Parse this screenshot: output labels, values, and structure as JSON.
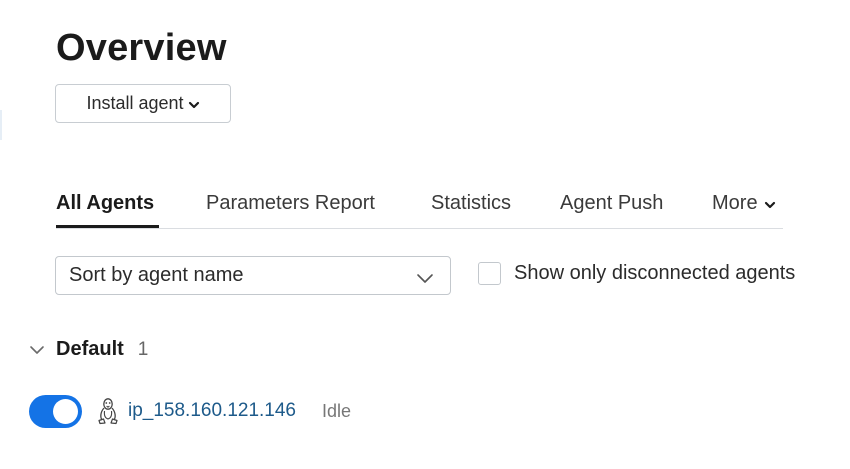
{
  "page": {
    "title": "Overview"
  },
  "toolbar": {
    "install_label": "Install agent"
  },
  "tabs": [
    {
      "label": "All Agents",
      "active": true
    },
    {
      "label": "Parameters Report",
      "active": false
    },
    {
      "label": "Statistics",
      "active": false
    },
    {
      "label": "Agent Push",
      "active": false
    },
    {
      "label": "More",
      "active": false
    }
  ],
  "filters": {
    "sort_value": "Sort by agent name",
    "disconnected_label": "Show only disconnected agents",
    "disconnected_checked": false
  },
  "groups": [
    {
      "name": "Default",
      "count": "1",
      "expanded": true,
      "agents": [
        {
          "name": "ip_158.160.121.146",
          "status": "Idle",
          "enabled": true,
          "os_icon": "linux-icon"
        }
      ]
    }
  ],
  "colors": {
    "accent": "#1473e6",
    "link": "#1d5a8a",
    "border": "#c3c8cd"
  }
}
